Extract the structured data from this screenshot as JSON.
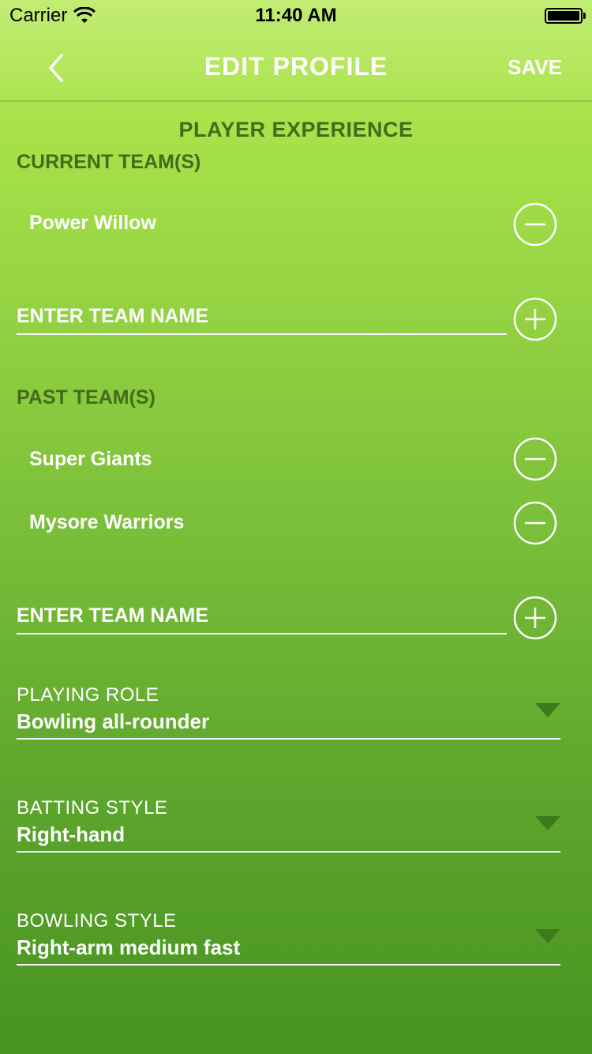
{
  "status_bar": {
    "carrier": "Carrier",
    "time": "11:40 AM"
  },
  "nav": {
    "title": "EDIT PROFILE",
    "save_label": "SAVE"
  },
  "section": {
    "title": "PLAYER EXPERIENCE"
  },
  "current_teams": {
    "label": "CURRENT TEAM(S)",
    "teams": [
      "Power Willow"
    ],
    "input_placeholder": "ENTER TEAM NAME"
  },
  "past_teams": {
    "label": "PAST TEAM(S)",
    "teams": [
      "Super Giants",
      "Mysore Warriors"
    ],
    "input_placeholder": "ENTER TEAM NAME"
  },
  "playing_role": {
    "label": "PLAYING ROLE",
    "value": "Bowling all-rounder"
  },
  "batting_style": {
    "label": "BATTING STYLE",
    "value": "Right-hand"
  },
  "bowling_style": {
    "label": "BOWLING STYLE",
    "value": "Right-arm medium fast"
  },
  "colors": {
    "gradient_top": "#c2ec74",
    "gradient_bottom": "#489421",
    "section_text": "#446b1b",
    "caret": "#3e7a1c"
  }
}
